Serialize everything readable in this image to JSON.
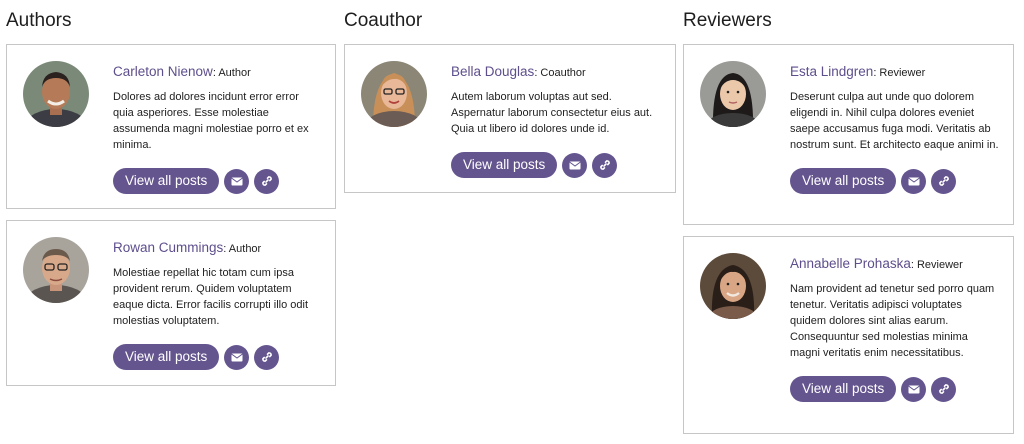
{
  "columns": [
    {
      "title": "Authors",
      "cards": [
        {
          "name": "Carleton Nienow",
          "role": ": Author",
          "bio": "Dolores ad dolores incidunt error error quia asperiores. Esse molestiae assumenda magni molestiae porro et ex minima.",
          "button": "View all posts"
        },
        {
          "name": "Rowan Cummings",
          "role": ": Author",
          "bio": "Molestiae repellat hic totam cum ipsa provident rerum. Quidem voluptatem eaque dicta. Error facilis corrupti illo odit molestias voluptatem.",
          "button": "View all posts"
        }
      ]
    },
    {
      "title": "Coauthor",
      "cards": [
        {
          "name": "Bella Douglas",
          "role": ": Coauthor",
          "bio": "Autem laborum voluptas aut sed. Aspernatur laborum consectetur eius aut. Quia ut libero id dolores unde id.",
          "button": "View all posts"
        }
      ]
    },
    {
      "title": "Reviewers",
      "cards": [
        {
          "name": "Esta Lindgren",
          "role": ": Reviewer",
          "bio": "Deserunt culpa aut unde quo dolorem eligendi in. Nihil culpa dolores eveniet saepe accusamus fuga modi. Veritatis ab nostrum sunt. Et architecto eaque animi in.",
          "button": "View all posts"
        },
        {
          "name": "Annabelle Prohaska",
          "role": ": Reviewer",
          "bio": "Nam provident ad tenetur sed porro quam tenetur. Veritatis adipisci voluptates quidem dolores sint alias earum. Consequuntur sed molestias minima magni veritatis enim necessitatibus.",
          "button": "View all posts"
        }
      ]
    }
  ],
  "icons": {
    "email": "email-icon",
    "link": "link-icon"
  },
  "colors": {
    "accent": "#65558f",
    "name_link": "#5e4e8c",
    "card_border": "#c6c6c6"
  }
}
